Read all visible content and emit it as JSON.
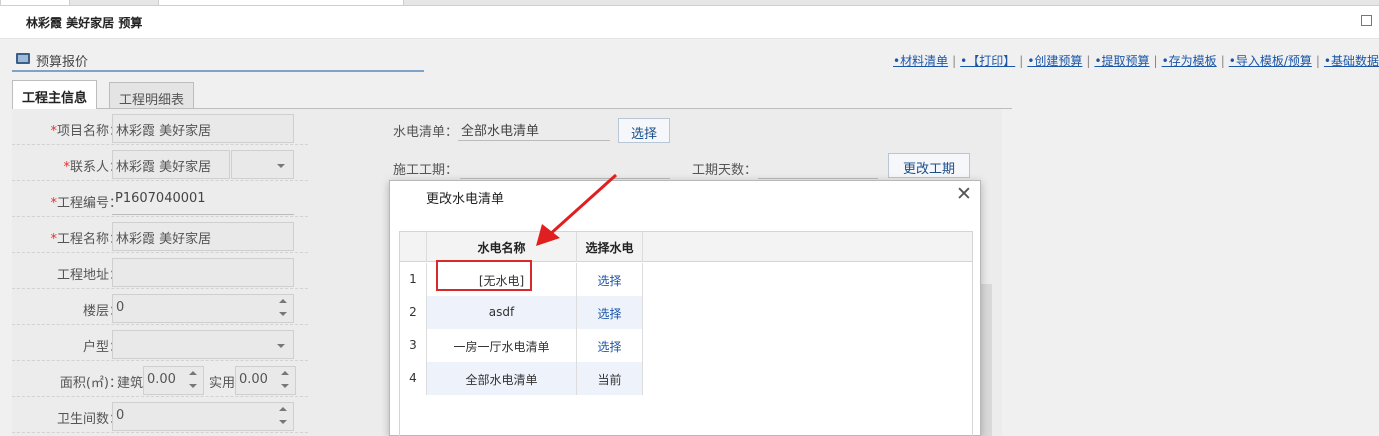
{
  "window": {
    "title": "林彩霞 美好家居 预算"
  },
  "section": {
    "title": "预算报价"
  },
  "toplinks": [
    {
      "label": "•材料清单"
    },
    {
      "label": "•【打印】"
    },
    {
      "label": "•创建预算"
    },
    {
      "label": "•提取预算"
    },
    {
      "label": "•存为模板"
    },
    {
      "label": "•导入模板/预算"
    },
    {
      "label": "•基础数据"
    }
  ],
  "tabs": [
    {
      "label": "工程主信息"
    },
    {
      "label": "工程明细表"
    }
  ],
  "form": {
    "project_name": {
      "label": "项目名称：",
      "value": "林彩霞 美好家居"
    },
    "contact": {
      "label": "联系人：",
      "value": "林彩霞 美好家居"
    },
    "project_no": {
      "label": "工程编号：",
      "value": "P1607040001"
    },
    "project_title": {
      "label": "工程名称：",
      "value": "林彩霞 美好家居"
    },
    "address": {
      "label": "工程地址：",
      "value": ""
    },
    "floor": {
      "label": "楼层：",
      "value": "0"
    },
    "house_type": {
      "label": "户型：",
      "value": ""
    },
    "area": {
      "label": "面积(㎡)：",
      "build_label": "建筑",
      "build_value": "0.00",
      "use_label": "实用",
      "use_value": "0.00"
    },
    "bathrooms": {
      "label": "卫生间数：",
      "value": "0"
    }
  },
  "right": {
    "water_list_label": "水电清单：",
    "water_list_value": "全部水电清单",
    "select_button": "选择",
    "construction_label": "施工工期：",
    "days_label": "工期天数：",
    "change_button": "更改工期"
  },
  "modal": {
    "title": "更改水电清单",
    "headers": [
      "水电名称",
      "选择水电"
    ],
    "rows": [
      {
        "idx": "1",
        "name": "[无水电]",
        "action": "选择",
        "link": true
      },
      {
        "idx": "2",
        "name": "asdf",
        "action": "选择",
        "link": true
      },
      {
        "idx": "3",
        "name": "一房一厅水电清单",
        "action": "选择",
        "link": true
      },
      {
        "idx": "4",
        "name": "全部水电清单",
        "action": "当前",
        "link": false
      }
    ]
  },
  "colors": {
    "link": "#1a56a8",
    "highlight": "#d62a2a",
    "row_alt": "#eef3fb"
  }
}
